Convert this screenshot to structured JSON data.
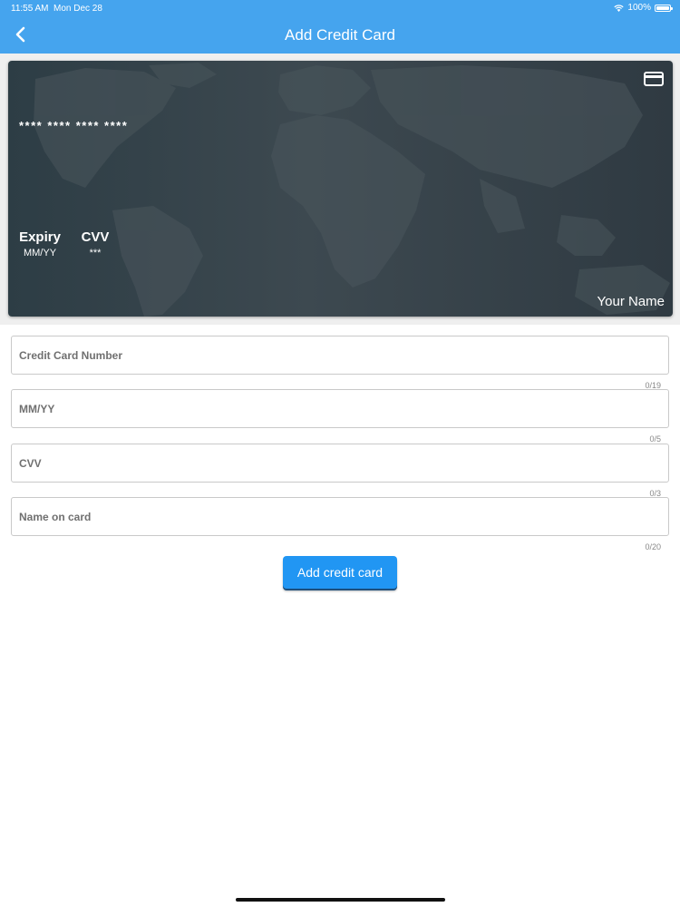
{
  "status_bar": {
    "time": "11:55 AM",
    "date": "Mon Dec 28",
    "battery": "100%",
    "icons": [
      "wifi-icon",
      "battery-icon"
    ]
  },
  "nav": {
    "title": "Add Credit Card",
    "back_icon": "chevron-left-icon"
  },
  "card": {
    "number": "**** **** **** ****",
    "expiry_label": "Expiry",
    "expiry_value": "MM/YY",
    "cvv_label": "CVV",
    "cvv_value": "***",
    "name": "Your Name",
    "icon": "credit-card-icon"
  },
  "form": {
    "card_number": {
      "placeholder": "Credit Card Number",
      "value": "",
      "counter": "0/19"
    },
    "expiry": {
      "placeholder": "MM/YY",
      "value": "",
      "counter": "0/5"
    },
    "cvv": {
      "placeholder": "CVV",
      "value": "",
      "counter": "0/3"
    },
    "name": {
      "placeholder": "Name on card",
      "value": "",
      "counter": "0/20"
    },
    "submit_label": "Add credit card"
  },
  "colors": {
    "accent": "#45a4ee",
    "button": "#2196f3",
    "card_bg": "#36434a"
  }
}
